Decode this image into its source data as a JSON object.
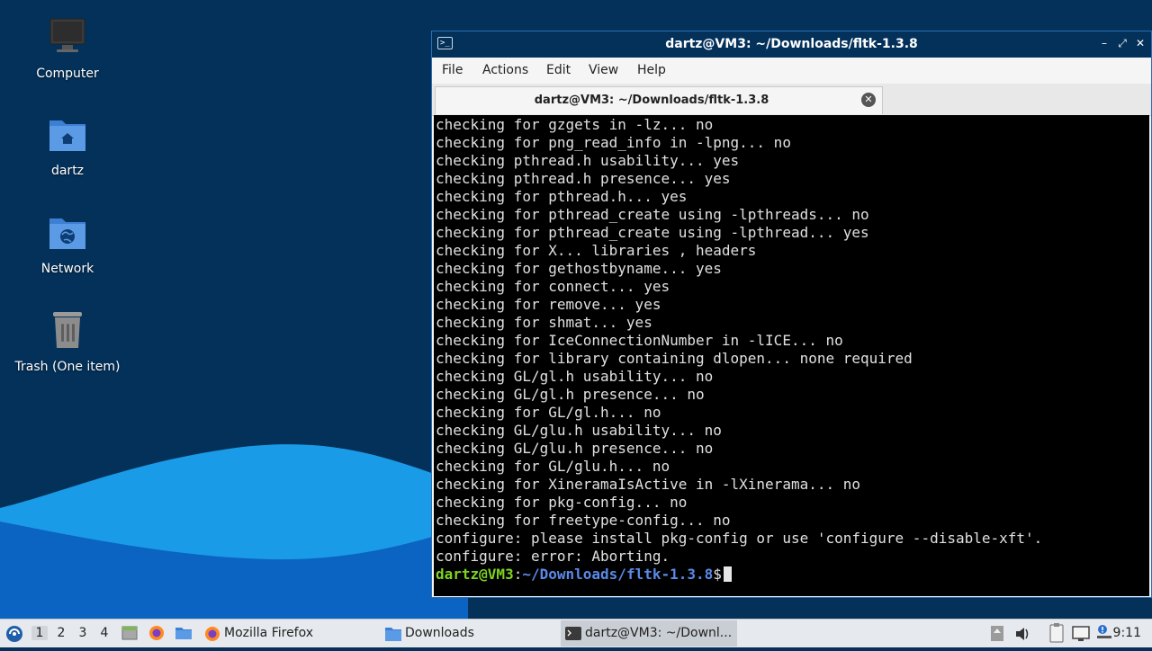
{
  "desktop": {
    "icons": [
      {
        "label": "Computer",
        "icon": "computer-icon"
      },
      {
        "label": "dartz",
        "icon": "home-folder-icon"
      },
      {
        "label": "Network",
        "icon": "network-folder-icon"
      },
      {
        "label": "Trash (One item)",
        "icon": "trash-icon"
      }
    ]
  },
  "terminal": {
    "title": "dartz@VM3: ~/Downloads/fltk-1.3.8",
    "menu": [
      "File",
      "Actions",
      "Edit",
      "View",
      "Help"
    ],
    "tab_label": "dartz@VM3: ~/Downloads/fltk-1.3.8",
    "lines": [
      "checking for gzgets in -lz... no",
      "checking for png_read_info in -lpng... no",
      "checking pthread.h usability... yes",
      "checking pthread.h presence... yes",
      "checking for pthread.h... yes",
      "checking for pthread_create using -lpthreads... no",
      "checking for pthread_create using -lpthread... yes",
      "checking for X... libraries , headers",
      "checking for gethostbyname... yes",
      "checking for connect... yes",
      "checking for remove... yes",
      "checking for shmat... yes",
      "checking for IceConnectionNumber in -lICE... no",
      "checking for library containing dlopen... none required",
      "checking GL/gl.h usability... no",
      "checking GL/gl.h presence... no",
      "checking for GL/gl.h... no",
      "checking GL/glu.h usability... no",
      "checking GL/glu.h presence... no",
      "checking for GL/glu.h... no",
      "checking for XineramaIsActive in -lXinerama... no",
      "checking for pkg-config... no",
      "checking for freetype-config... no",
      "configure: please install pkg-config or use 'configure --disable-xft'.",
      "configure: error: Aborting."
    ],
    "prompt": {
      "user_host": "dartz@VM3",
      "sep": ":",
      "path": "~/Downloads/fltk-1.3.8",
      "symbol": "$"
    }
  },
  "taskbar": {
    "workspaces": [
      "1",
      "2",
      "3",
      "4"
    ],
    "active_workspace": "1",
    "tasks": [
      {
        "label": "Mozilla Firefox",
        "icon": "firefox-icon"
      },
      {
        "label": "Downloads",
        "icon": "folder-icon"
      },
      {
        "label": "dartz@VM3: ~/Downl...",
        "icon": "terminal-icon"
      }
    ],
    "clock": "9:11"
  },
  "colors": {
    "desktop_bg": "#04315a",
    "wave_light": "#1a9be8",
    "wave_dark": "#0b63c2",
    "prompt_user": "#7ed321",
    "prompt_path": "#5a8ae8"
  }
}
